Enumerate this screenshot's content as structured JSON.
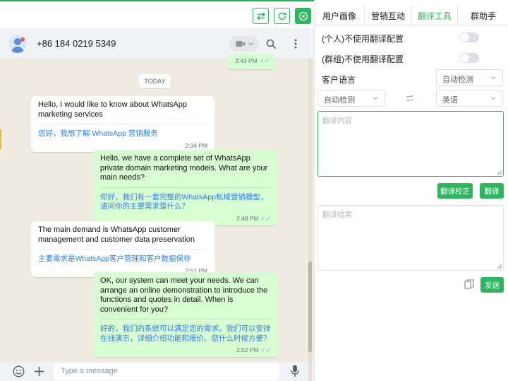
{
  "toolbar": {
    "swap_icon": "swap-arrows-icon",
    "refresh_icon": "refresh-icon",
    "close_icon": "close-circle-icon",
    "accent": "#2fb45f"
  },
  "chat": {
    "header": {
      "phone": "+86 184 0219 5349",
      "icons": [
        "avatar",
        "video-camera-icon",
        "search-icon",
        "more-vertical-icon"
      ]
    },
    "previous_time": "3:43 PM",
    "date_divider": "TODAY",
    "messages": [
      {
        "direction": "in",
        "text": "Hello, I would like to know about WhatsApp marketing services",
        "translation": "您好，我想了解 WhatsApp 营销服务",
        "time": "2:34 PM"
      },
      {
        "direction": "out",
        "text": "Hello, we have a complete set of WhatsApp private domain marketing models. What are your main needs?",
        "translation": "你好，我们有一套完整的WhatsApp私域营销模型，请问你的主要需求是什么？",
        "time": "2:48 PM"
      },
      {
        "direction": "in",
        "text": "The main demand is WhatsApp customer management and customer data preservation",
        "translation": "主要需求是WhatsApp客户管理和客户数据保存",
        "time": "2:51 PM"
      },
      {
        "direction": "out",
        "text": "OK, our system can meet your needs. We can arrange an online demonstration to introduce the functions and quotes in detail. When is convenient for you?",
        "translation": "好的，我们的系统可以满足您的需求。我们可以安排在线演示，详细介绍功能和报价。您什么时候方便？",
        "time": "2:52 PM"
      }
    ],
    "composer": {
      "placeholder": "Type a message",
      "icons": [
        "emoji-icon",
        "plus-icon",
        "translate-icon",
        "microphone-icon"
      ]
    },
    "colors": {
      "bg": "#efeae2",
      "outgoing": "#d9fdd3",
      "translation": "#2f7fe0"
    }
  },
  "panel": {
    "tabs": [
      "用户画像",
      "营销互动",
      "翻译工具",
      "群助手"
    ],
    "active_tab": "翻译工具",
    "toggles": [
      {
        "label": "(个人)不使用翻译配置",
        "on": false
      },
      {
        "label": "(群组)不使用翻译配置",
        "on": false
      }
    ],
    "customer_language_label": "客户语言",
    "customer_language_value": "自动检测",
    "source_language": "自动检测",
    "target_language": "英语",
    "input_placeholder": "翻译内容",
    "correct_button": "翻译校正",
    "translate_button": "翻译",
    "result_placeholder": "翻译结果",
    "send_button": "发送"
  }
}
